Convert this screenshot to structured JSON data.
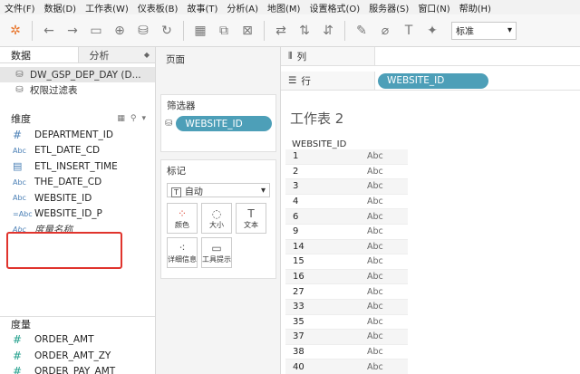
{
  "menu": [
    "文件(F)",
    "数据(D)",
    "工作表(W)",
    "仪表板(B)",
    "故事(T)",
    "分析(A)",
    "地图(M)",
    "设置格式(O)",
    "服务器(S)",
    "窗口(N)",
    "帮助(H)"
  ],
  "toolbar": {
    "fit_select": "标准"
  },
  "left": {
    "tab_data": "数据",
    "tab_analysis": "分析",
    "datasource": "DW_GSP_DEP_DAY (D...",
    "filter_label": "权限过滤表",
    "dimensions_head": "维度",
    "dimensions": [
      {
        "icon": "#",
        "label": "DEPARTMENT_ID"
      },
      {
        "icon": "Abc",
        "label": "ETL_DATE_CD"
      },
      {
        "icon": "cal",
        "label": "ETL_INSERT_TIME"
      },
      {
        "icon": "Abc",
        "label": "THE_DATE_CD"
      },
      {
        "icon": "Abc",
        "label": "WEBSITE_ID"
      },
      {
        "icon": "Abc",
        "label": "WEBSITE_ID_P"
      },
      {
        "icon": "Abc",
        "label": "度量名称"
      }
    ],
    "measures_head": "度量",
    "measures": [
      "ORDER_AMT",
      "ORDER_AMT_ZY",
      "ORDER_PAY_AMT"
    ]
  },
  "mid": {
    "pages": "页面",
    "filters": "筛选器",
    "filter_pill": "WEBSITE_ID",
    "marks": "标记",
    "mark_type": "自动",
    "mark_buttons": [
      "颜色",
      "大小",
      "文本",
      "详细信息",
      "工具提示"
    ]
  },
  "right": {
    "columns_label": "列",
    "rows_label": "行",
    "row_pill": "WEBSITE_ID",
    "sheet_title": "工作表 2",
    "column_header": "WEBSITE_ID",
    "rows": [
      "1",
      "2",
      "3",
      "4",
      "6",
      "9",
      "14",
      "15",
      "16",
      "27",
      "33",
      "35",
      "37",
      "38",
      "40"
    ],
    "abc": "Abc"
  }
}
